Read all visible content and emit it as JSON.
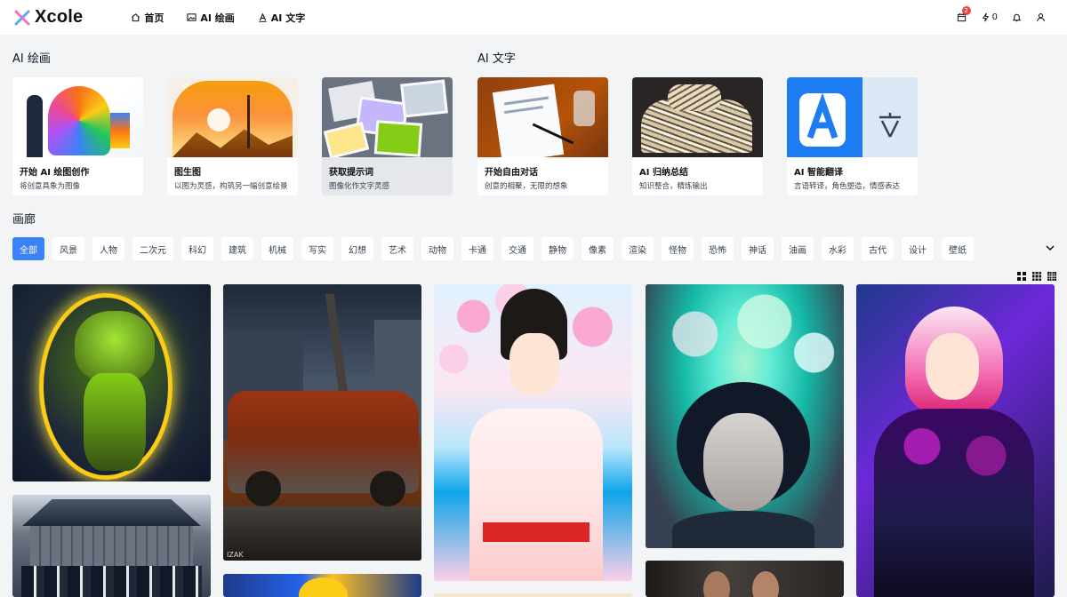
{
  "app": {
    "name": "Xcole"
  },
  "nav": [
    {
      "label": "首页",
      "icon": "home-icon"
    },
    {
      "label": "AI 绘画",
      "icon": "image-icon"
    },
    {
      "label": "AI 文字",
      "icon": "text-icon"
    }
  ],
  "header_right": {
    "calendar_badge": "2",
    "energy_count": "0",
    "icons": [
      "calendar-icon",
      "lightning-icon",
      "bell-icon",
      "user-icon"
    ]
  },
  "sections": {
    "painting_title": "AI 绘画",
    "text_title": "AI 文字",
    "gallery_title": "画廊"
  },
  "cards": [
    {
      "title": "开始 AI 绘图创作",
      "desc": "将创意具象为图像"
    },
    {
      "title": "图生图",
      "desc": "以图为灵感，构筑另一幅创意绘景"
    },
    {
      "title": "获取提示词",
      "desc": "图像化作文字灵感"
    },
    {
      "title": "开始自由对话",
      "desc": "创意的相聚，无限的想象"
    },
    {
      "title": "AI 归纳总结",
      "desc": "知识整合，精炼输出"
    },
    {
      "title": "AI 智能翻译",
      "desc": "言语转译，角色塑造，情感表达"
    }
  ],
  "tags": [
    "全部",
    "风景",
    "人物",
    "二次元",
    "科幻",
    "建筑",
    "机械",
    "写实",
    "幻想",
    "艺术",
    "动物",
    "卡通",
    "交通",
    "静物",
    "像素",
    "渲染",
    "怪物",
    "恐怖",
    "神话",
    "油画",
    "水彩",
    "古代",
    "设计",
    "壁纸"
  ],
  "active_tag": "全部",
  "gallery": [
    {
      "name": "gallery-image-green-creature"
    },
    {
      "name": "gallery-image-japanese-house"
    },
    {
      "name": "gallery-image-rusted-van",
      "watermark": "IZAK"
    },
    {
      "name": "gallery-image-golden-art"
    },
    {
      "name": "gallery-image-hanfu-girl"
    },
    {
      "name": "gallery-image-cloud-portrait"
    },
    {
      "name": "gallery-image-two-women"
    },
    {
      "name": "gallery-image-dark-armor-woman"
    }
  ]
}
